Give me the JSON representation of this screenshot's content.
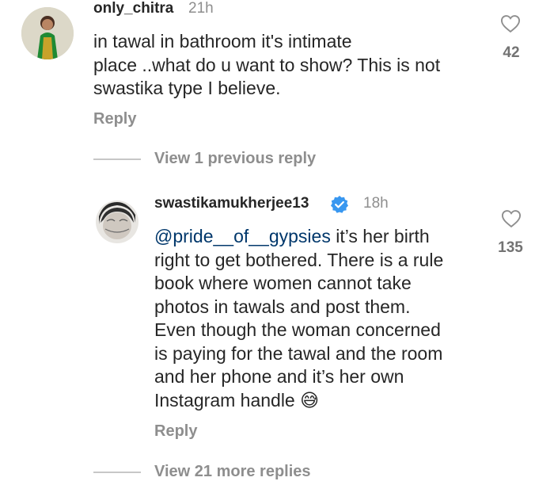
{
  "comment1": {
    "username": "only_chitra",
    "time": "21h",
    "lines": [
      "in tawal in bathroom it's intimate",
      "place ..what do u want to show? This is not",
      "swastika type I believe."
    ],
    "reply_label": "Reply",
    "likes": "42"
  },
  "view_previous": "View 1 previous reply",
  "comment2": {
    "username": "swastikamukherjee13",
    "time": "18h",
    "mention": "@pride__of__gypsies",
    "line1_rest": " it’s her birth",
    "lines": [
      "right to get bothered. There is a rule",
      "book where women cannot take",
      "photos in tawals and post them.",
      "Even though the woman concerned",
      "is paying for the tawal and the room",
      "and her phone and it’s her own"
    ],
    "last_line": "Instagram handle ",
    "emoji": "😅",
    "reply_label": "Reply",
    "likes": "135"
  },
  "view_more": "View 21 more replies",
  "colors": {
    "verified": "#3897f0",
    "mention": "#00376b",
    "secondary_text": "#8e8e8e"
  }
}
